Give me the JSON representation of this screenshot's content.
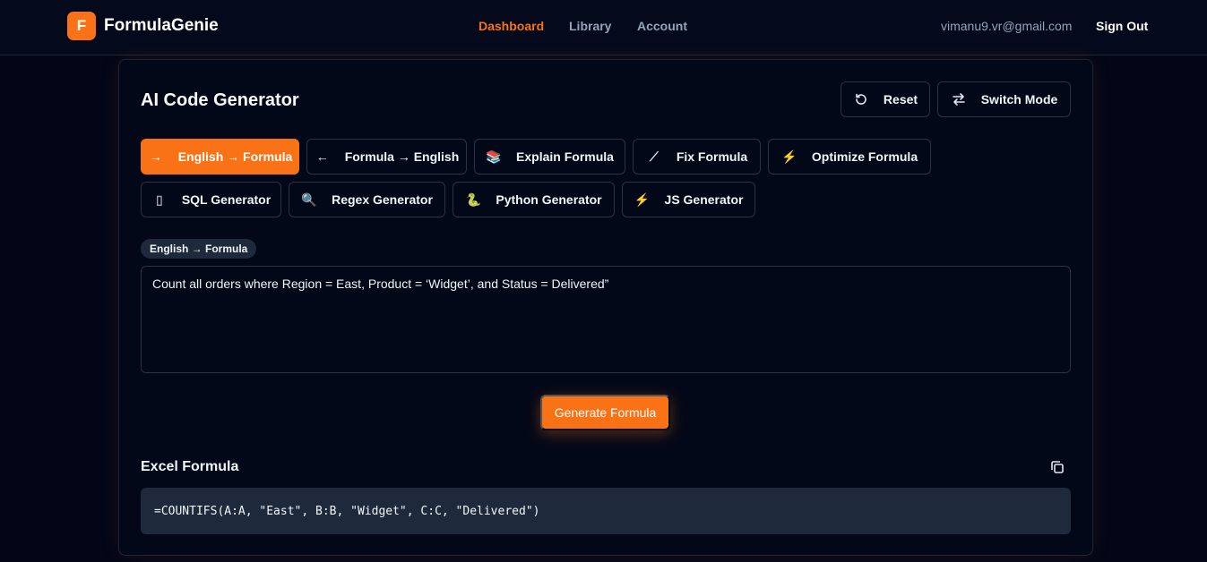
{
  "header": {
    "logo_letter": "F",
    "brand": "FormulaGenie",
    "nav": [
      {
        "label": "Dashboard",
        "active": true
      },
      {
        "label": "Library",
        "active": false
      },
      {
        "label": "Account",
        "active": false
      }
    ],
    "user_email": "vimanu9.vr@gmail.com",
    "sign_out": "Sign Out"
  },
  "card": {
    "title": "AI Code Generator",
    "actions": [
      {
        "label": "Reset",
        "icon": "reset-icon"
      },
      {
        "label": "Switch Mode",
        "icon": "swap-icon"
      }
    ],
    "modes_row1": [
      {
        "label": "English → Formula",
        "icon": "arrow-right-icon",
        "glyph": "→",
        "active": true
      },
      {
        "label": "Formula → English",
        "icon": "arrow-left-icon",
        "glyph": "←",
        "active": false
      },
      {
        "label": "Explain Formula",
        "icon": "books-icon",
        "glyph": "📚",
        "active": false
      },
      {
        "label": "Fix Formula",
        "icon": "wand-icon",
        "glyph": "⟋",
        "active": false
      },
      {
        "label": "Optimize Formula",
        "icon": "lightning-icon",
        "glyph": "⚡",
        "active": false
      }
    ],
    "modes_row2": [
      {
        "label": "SQL Generator",
        "icon": "database-icon",
        "glyph": "▯",
        "active": false
      },
      {
        "label": "Regex Generator",
        "icon": "magnifier-icon",
        "glyph": "🔍",
        "active": false
      },
      {
        "label": "Python Generator",
        "icon": "snake-icon",
        "glyph": "🐍",
        "active": false
      },
      {
        "label": "JS Generator",
        "icon": "lightning-icon",
        "glyph": "⚡",
        "active": false
      }
    ],
    "mode_badge": "English → Formula",
    "prompt_text": "Count all orders where Region = East, Product = ‘Widget’, and Status = Delivered”",
    "generate_label": "Generate Formula",
    "output_label": "Excel Formula",
    "output_value": "=COUNTIFS(A:A, \"East\", B:B, \"Widget\", C:C, \"Delivered\")"
  },
  "colors": {
    "accent": "#f97316",
    "background": "#020617",
    "panel": "#030818",
    "code_bg": "#1e293b",
    "border": "#2a3345"
  }
}
